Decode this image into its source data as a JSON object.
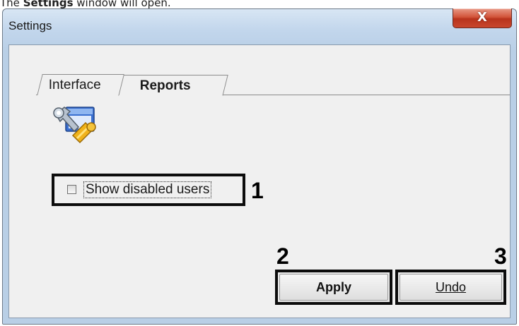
{
  "caption": {
    "prefix": "The",
    "bold": "Settings",
    "suffix": "window will open."
  },
  "window": {
    "title": "Settings",
    "close_glyph": "X"
  },
  "tabs": [
    {
      "label": "Interface",
      "selected": false
    },
    {
      "label": "Reports",
      "selected": true
    }
  ],
  "icons": {
    "settings": "settings-wrench-icon"
  },
  "options": {
    "show_disabled_users": {
      "label": "Show disabled users",
      "checked": false
    }
  },
  "buttons": {
    "apply": "Apply",
    "undo": "Undo"
  },
  "callouts": [
    "1",
    "2",
    "3"
  ],
  "colors": {
    "close_button": "#c8462c",
    "window_frame": "#c2d6ec",
    "client_bg": "#f0f0f0",
    "highlight_border": "#0c0c0c"
  }
}
